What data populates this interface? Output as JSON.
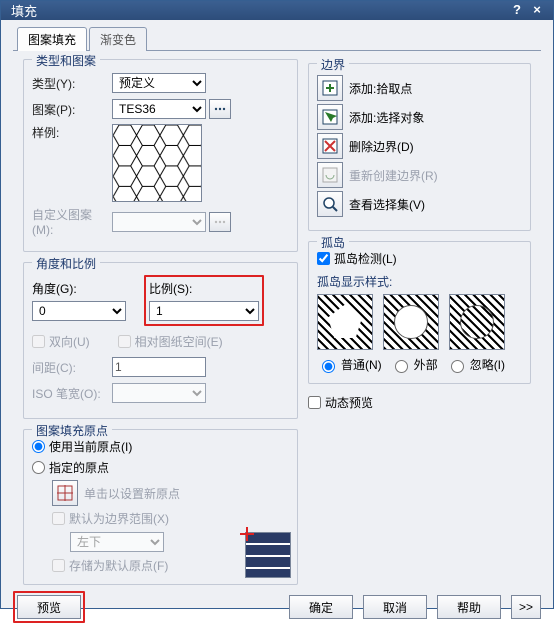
{
  "titlebar": {
    "title": "填充"
  },
  "tabs": {
    "pattern": "图案填充",
    "gradient": "渐变色"
  },
  "groups": {
    "type_pattern": {
      "legend": "类型和图案",
      "type_label": "类型(Y):",
      "pattern_label": "图案(P):",
      "sample_label": "样例:",
      "custom_label": "自定义图案(M):"
    },
    "angle_scale": {
      "legend": "角度和比例",
      "angle_label": "角度(G):",
      "scale_label": "比例(S):",
      "bidir_label": "双向(U)",
      "relpaper_label": "相对图纸空间(E)",
      "spacing_label": "间距(C):",
      "iso_label": "ISO 笔宽(O):"
    },
    "origin": {
      "legend": "图案填充原点",
      "use_current": "使用当前原点(I)",
      "specified": "指定的原点",
      "click_set": "单击以设置新原点",
      "default_bound": "默认为边界范围(X)",
      "store_default": "存储为默认原点(F)"
    },
    "boundary": {
      "legend": "边界",
      "add_pick": "添加:拾取点",
      "add_select": "添加:选择对象",
      "remove_boundary": "删除边界(D)",
      "recreate_boundary": "重新创建边界(R)",
      "view_selection": "查看选择集(V)"
    },
    "island": {
      "legend": "孤岛",
      "detect": "孤岛检测(L)",
      "display_style": "孤岛显示样式:",
      "normal": "普通(N)",
      "outer": "外部",
      "ignore": "忽略(I)"
    },
    "dynamic_preview": "动态预览"
  },
  "values": {
    "type_selected": "预定义",
    "pattern_selected": "TES36",
    "angle_selected": "0",
    "scale_selected": "1",
    "spacing": "1",
    "iso": "",
    "origin_corner": "左下"
  },
  "buttons": {
    "preview": "预览",
    "ok": "确定",
    "cancel": "取消",
    "help": "帮助",
    "expand": ">>"
  }
}
